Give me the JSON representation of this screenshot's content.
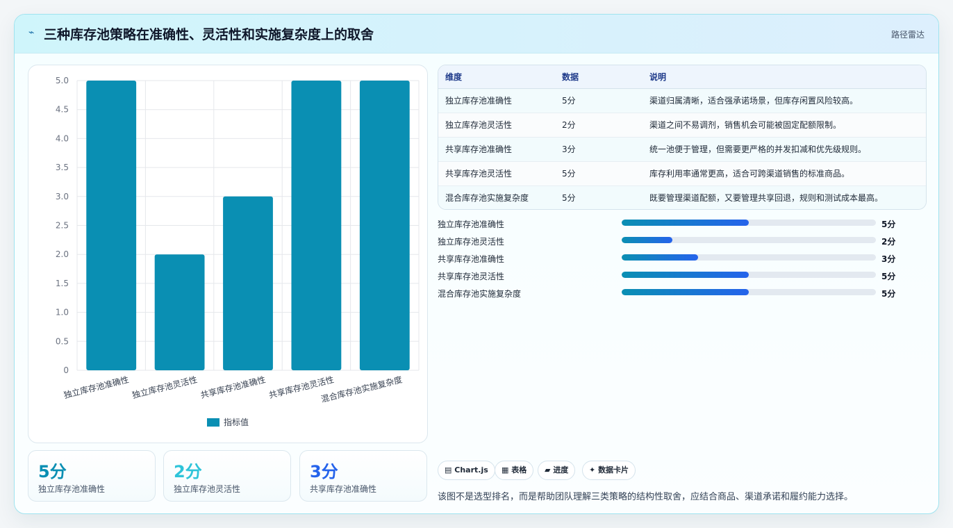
{
  "header": {
    "logo_icon": "pulse-icon",
    "logo_glyph": "⌁",
    "title": "三种库存池策略在准确性、灵活性和实施复杂度上的取舍",
    "tag": "路径雷达"
  },
  "colors": {
    "bar": "#0a8fb3",
    "accent": "#2563eb",
    "kpi1": "#0a8fb3",
    "kpi2": "#2ec4d9",
    "kpi3": "#2563eb"
  },
  "chart_data": {
    "type": "bar",
    "categories": [
      "独立库存池准确性",
      "独立库存池灵活性",
      "共享库存池准确性",
      "共享库存池灵活性",
      "混合库存池实施复杂度"
    ],
    "series": [
      {
        "name": "指标值",
        "values": [
          5,
          2,
          3,
          5,
          5
        ]
      }
    ],
    "ylim": [
      0,
      5
    ],
    "yticks": [
      "0",
      "0.5",
      "1.0",
      "1.5",
      "2.0",
      "2.5",
      "3.0",
      "3.5",
      "4.0",
      "4.5",
      "5.0"
    ],
    "grid": true,
    "legend": "bottom"
  },
  "kpis": [
    {
      "value": "5分",
      "label": "独立库存池准确性"
    },
    {
      "value": "2分",
      "label": "独立库存池灵活性"
    },
    {
      "value": "3分",
      "label": "共享库存池准确性"
    }
  ],
  "table": {
    "headers": [
      "维度",
      "数据",
      "说明"
    ],
    "rows": [
      [
        "独立库存池准确性",
        "5分",
        "渠道归属清晰，适合强承诺场景，但库存闲置风险较高。"
      ],
      [
        "独立库存池灵活性",
        "2分",
        "渠道之间不易调剂，销售机会可能被固定配额限制。"
      ],
      [
        "共享库存池准确性",
        "3分",
        "统一池便于管理，但需要更严格的并发扣减和优先级规则。"
      ],
      [
        "共享库存池灵活性",
        "5分",
        "库存利用率通常更高，适合可跨渠道销售的标准商品。"
      ],
      [
        "混合库存池实施复杂度",
        "5分",
        "既要管理渠道配额，又要管理共享回退，规则和测试成本最高。"
      ]
    ]
  },
  "progress": [
    {
      "label": "独立库存池准确性",
      "value": 5,
      "display": "5分",
      "fraction": 0.5
    },
    {
      "label": "独立库存池灵活性",
      "value": 2,
      "display": "2分",
      "fraction": 0.2
    },
    {
      "label": "共享库存池准确性",
      "value": 3,
      "display": "3分",
      "fraction": 0.3
    },
    {
      "label": "共享库存池灵活性",
      "value": 5,
      "display": "5分",
      "fraction": 0.5
    },
    {
      "label": "混合库存池实施复杂度",
      "value": 5,
      "display": "5分",
      "fraction": 0.5
    }
  ],
  "chips": [
    {
      "icon": "chart-icon",
      "glyph": "▤",
      "label": "Chart.js"
    },
    {
      "icon": "table-icon",
      "glyph": "▦",
      "label": "表格"
    },
    {
      "icon": "progress-icon",
      "glyph": "▰",
      "label": "进度"
    },
    {
      "icon": "sparkle-icon",
      "glyph": "✦",
      "label": "数据卡片"
    }
  ],
  "note": "该图不是选型排名，而是帮助团队理解三类策略的结构性取舍，应结合商品、渠道承诺和履约能力选择。"
}
